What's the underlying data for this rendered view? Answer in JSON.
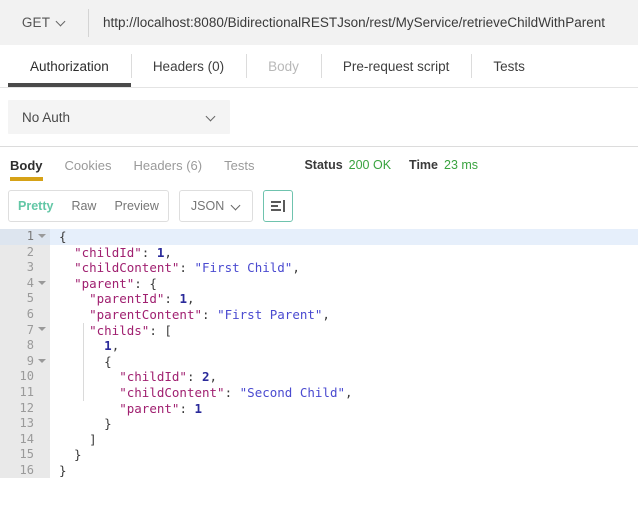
{
  "request": {
    "method": "GET",
    "method_icon": "chevron-down-icon",
    "url": "http://localhost:8080/BidirectionalRESTJson/rest/MyService/retrieveChildWithParent",
    "tabs": [
      {
        "label": "Authorization",
        "active": true,
        "disabled": false
      },
      {
        "label": "Headers (0)",
        "active": false,
        "disabled": false
      },
      {
        "label": "Body",
        "active": false,
        "disabled": true
      },
      {
        "label": "Pre-request script",
        "active": false,
        "disabled": false
      },
      {
        "label": "Tests",
        "active": false,
        "disabled": false
      }
    ],
    "active_tab_underline_color": "#4a4a4a",
    "auth": {
      "selected": "No Auth",
      "icon": "chevron-down-icon"
    }
  },
  "response": {
    "tabs": [
      {
        "label": "Body",
        "active": true
      },
      {
        "label": "Cookies",
        "active": false
      },
      {
        "label": "Headers (6)",
        "active": false
      },
      {
        "label": "Tests",
        "active": false
      }
    ],
    "active_tab_underline_color": "#d6a217",
    "status_label": "Status",
    "status_value": "200 OK",
    "time_label": "Time",
    "time_value": "23 ms",
    "status_color": "#3aa340",
    "toolbar": {
      "views": [
        {
          "label": "Pretty",
          "active": true
        },
        {
          "label": "Raw",
          "active": false
        },
        {
          "label": "Preview",
          "active": false
        }
      ],
      "active_view_color": "#63c7a6",
      "language": "JSON",
      "language_icon": "chevron-down-icon",
      "wrap_button_icon": "wrap-lines-icon"
    },
    "body": {
      "highlighted_line": 1,
      "lines": [
        {
          "n": 1,
          "fold": true,
          "tokens": [
            {
              "t": "pun",
              "v": "{"
            }
          ]
        },
        {
          "n": 2,
          "fold": false,
          "tokens": [
            {
              "t": "pun",
              "v": "  "
            },
            {
              "t": "key",
              "v": "\"childId\""
            },
            {
              "t": "pun",
              "v": ": "
            },
            {
              "t": "num",
              "v": "1"
            },
            {
              "t": "pun",
              "v": ","
            }
          ]
        },
        {
          "n": 3,
          "fold": false,
          "tokens": [
            {
              "t": "pun",
              "v": "  "
            },
            {
              "t": "key",
              "v": "\"childContent\""
            },
            {
              "t": "pun",
              "v": ": "
            },
            {
              "t": "str",
              "v": "\"First Child\""
            },
            {
              "t": "pun",
              "v": ","
            }
          ]
        },
        {
          "n": 4,
          "fold": true,
          "tokens": [
            {
              "t": "pun",
              "v": "  "
            },
            {
              "t": "key",
              "v": "\"parent\""
            },
            {
              "t": "pun",
              "v": ": {"
            }
          ]
        },
        {
          "n": 5,
          "fold": false,
          "tokens": [
            {
              "t": "pun",
              "v": "    "
            },
            {
              "t": "key",
              "v": "\"parentId\""
            },
            {
              "t": "pun",
              "v": ": "
            },
            {
              "t": "num",
              "v": "1"
            },
            {
              "t": "pun",
              "v": ","
            }
          ]
        },
        {
          "n": 6,
          "fold": false,
          "tokens": [
            {
              "t": "pun",
              "v": "    "
            },
            {
              "t": "key",
              "v": "\"parentContent\""
            },
            {
              "t": "pun",
              "v": ": "
            },
            {
              "t": "str",
              "v": "\"First Parent\""
            },
            {
              "t": "pun",
              "v": ","
            }
          ]
        },
        {
          "n": 7,
          "fold": true,
          "tokens": [
            {
              "t": "pun",
              "v": "    "
            },
            {
              "t": "key",
              "v": "\"childs\""
            },
            {
              "t": "pun",
              "v": ": ["
            }
          ]
        },
        {
          "n": 8,
          "fold": false,
          "tokens": [
            {
              "t": "pun",
              "v": "      "
            },
            {
              "t": "num",
              "v": "1"
            },
            {
              "t": "pun",
              "v": ","
            }
          ]
        },
        {
          "n": 9,
          "fold": true,
          "tokens": [
            {
              "t": "pun",
              "v": "      {"
            }
          ]
        },
        {
          "n": 10,
          "fold": false,
          "tokens": [
            {
              "t": "pun",
              "v": "        "
            },
            {
              "t": "key",
              "v": "\"childId\""
            },
            {
              "t": "pun",
              "v": ": "
            },
            {
              "t": "num",
              "v": "2"
            },
            {
              "t": "pun",
              "v": ","
            }
          ]
        },
        {
          "n": 11,
          "fold": false,
          "tokens": [
            {
              "t": "pun",
              "v": "        "
            },
            {
              "t": "key",
              "v": "\"childContent\""
            },
            {
              "t": "pun",
              "v": ": "
            },
            {
              "t": "str",
              "v": "\"Second Child\""
            },
            {
              "t": "pun",
              "v": ","
            }
          ]
        },
        {
          "n": 12,
          "fold": false,
          "tokens": [
            {
              "t": "pun",
              "v": "        "
            },
            {
              "t": "key",
              "v": "\"parent\""
            },
            {
              "t": "pun",
              "v": ": "
            },
            {
              "t": "num",
              "v": "1"
            }
          ]
        },
        {
          "n": 13,
          "fold": false,
          "tokens": [
            {
              "t": "pun",
              "v": "      }"
            }
          ]
        },
        {
          "n": 14,
          "fold": false,
          "tokens": [
            {
              "t": "pun",
              "v": "    ]"
            }
          ]
        },
        {
          "n": 15,
          "fold": false,
          "tokens": [
            {
              "t": "pun",
              "v": "  }"
            }
          ]
        },
        {
          "n": 16,
          "fold": false,
          "tokens": [
            {
              "t": "pun",
              "v": "}"
            }
          ]
        }
      ]
    }
  }
}
